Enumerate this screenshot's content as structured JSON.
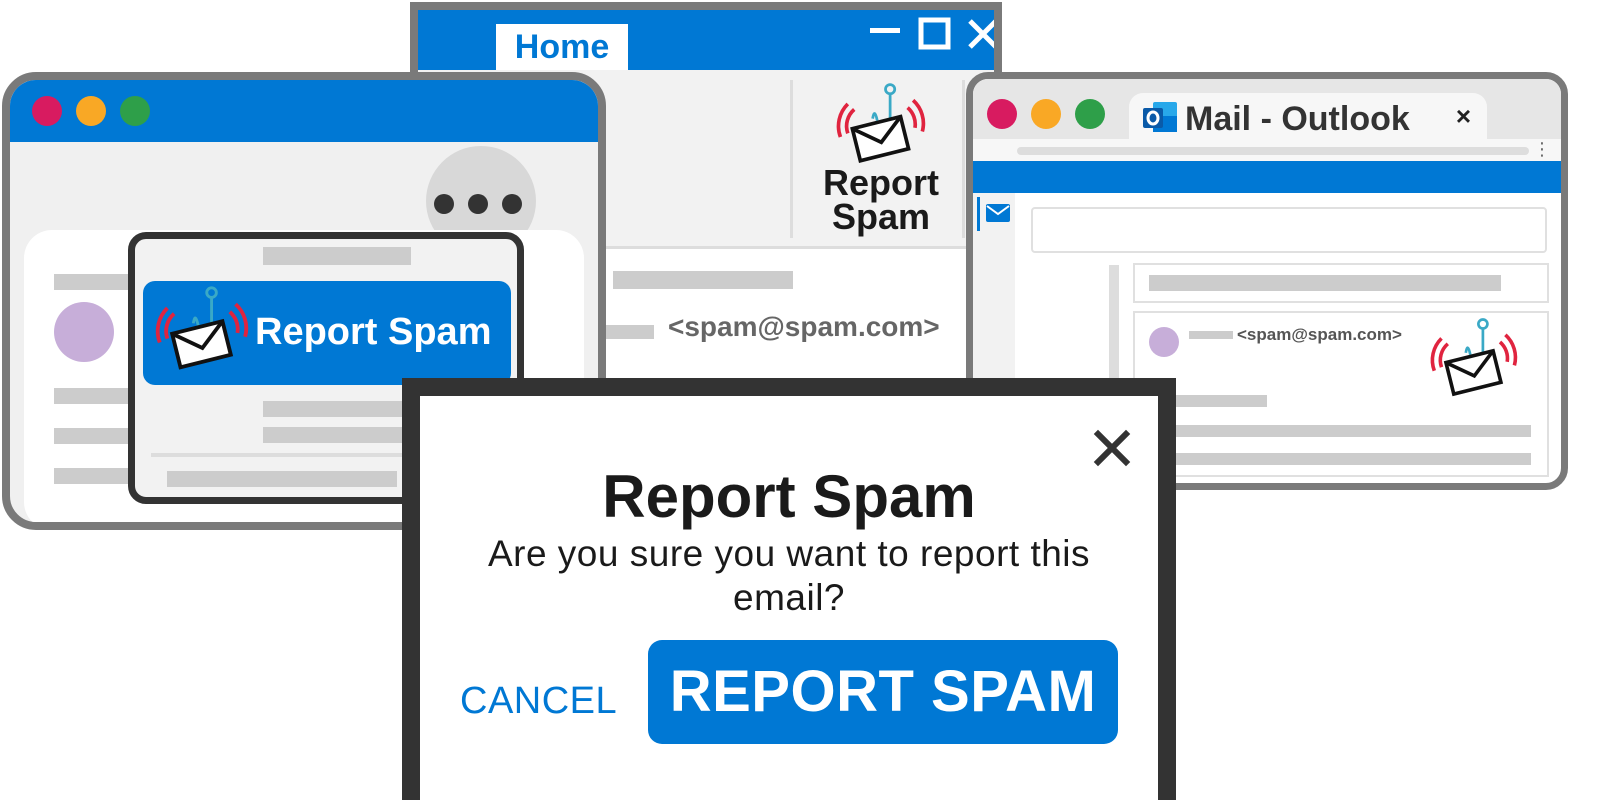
{
  "colors": {
    "accent": "#0078d4",
    "traffic_red": "#d81b60",
    "traffic_yellow": "#f9a825",
    "traffic_green": "#2e9f49",
    "avatar": "#c7aed9",
    "placeholder_bar": "#cccccc",
    "frame_gray": "#7a7a7a",
    "dialog_frame": "#333333"
  },
  "desktop_window": {
    "tab_label": "Home",
    "report_label_line1": "Report",
    "report_label_line2": "Spam",
    "sender_fragment": "m>",
    "sender_email": "<spam@spam.com>"
  },
  "mac_window": {
    "menu_report_label": "Report Spam"
  },
  "web_window": {
    "tab_title": "Mail - Outlook",
    "tab_close": "×",
    "sender_email": "<spam@spam.com>"
  },
  "dialog": {
    "title": "Report Spam",
    "message": "Are you sure you want to report this email?",
    "cancel_label": "CANCEL",
    "confirm_label": "REPORT SPAM"
  },
  "icons": {
    "report": "phishing-hook-envelope-icon",
    "mail": "mail-icon",
    "outlook": "outlook-logo-icon",
    "more": "more-options-icon",
    "close": "close-icon",
    "minimize": "minimize-icon",
    "maximize": "maximize-icon"
  }
}
